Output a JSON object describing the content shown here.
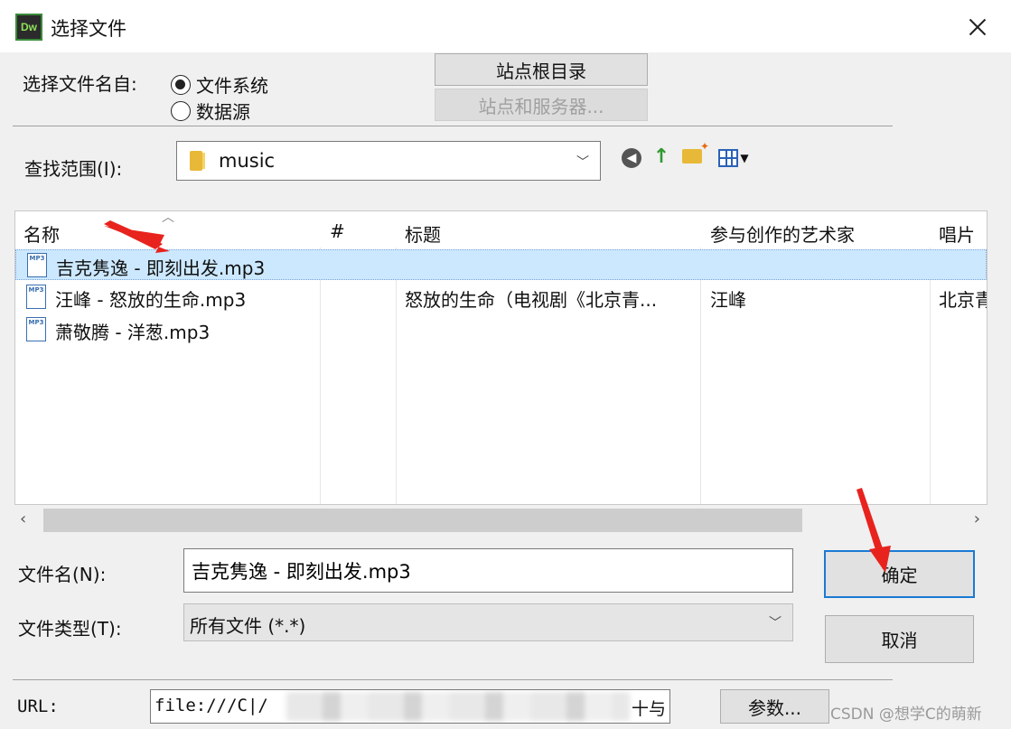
{
  "window": {
    "title": "选择文件",
    "app_icon_text": "Dw"
  },
  "source": {
    "label": "选择文件名自:",
    "options": [
      {
        "label": "文件系统",
        "selected": true
      },
      {
        "label": "数据源",
        "selected": false
      }
    ],
    "site_root_button": "站点根目录",
    "site_server_button": "站点和服务器..."
  },
  "lookin": {
    "label": "查找范围(I):",
    "value": "music"
  },
  "file_list": {
    "columns": [
      "名称",
      "#",
      "标题",
      "参与创作的艺术家",
      "唱片集"
    ],
    "icon_label": "MP3",
    "rows": [
      {
        "name": "吉克隽逸 - 即刻出发.mp3",
        "num": "",
        "title": "",
        "artist": "",
        "album": "",
        "selected": true
      },
      {
        "name": "汪峰 - 怒放的生命.mp3",
        "num": "",
        "title": "怒放的生命（电视剧《北京青...",
        "artist": "汪峰",
        "album": "北京青",
        "selected": false
      },
      {
        "name": "萧敬腾 - 洋葱.mp3",
        "num": "",
        "title": "",
        "artist": "",
        "album": "",
        "selected": false
      }
    ]
  },
  "filename": {
    "label": "文件名(N):",
    "value": "吉克隽逸 - 即刻出发.mp3"
  },
  "filetype": {
    "label": "文件类型(T):",
    "value": "所有文件 (*.*)"
  },
  "buttons": {
    "ok": "确定",
    "cancel": "取消",
    "params": "参数..."
  },
  "url": {
    "label": "URL:",
    "value_start": "file:///C|/",
    "value_end": "十与"
  },
  "watermark": "CSDN @想学C的萌新",
  "colors": {
    "selection": "#cce8ff",
    "ok_border": "#1a7ad4",
    "annotation_arrow": "#e8231d"
  }
}
